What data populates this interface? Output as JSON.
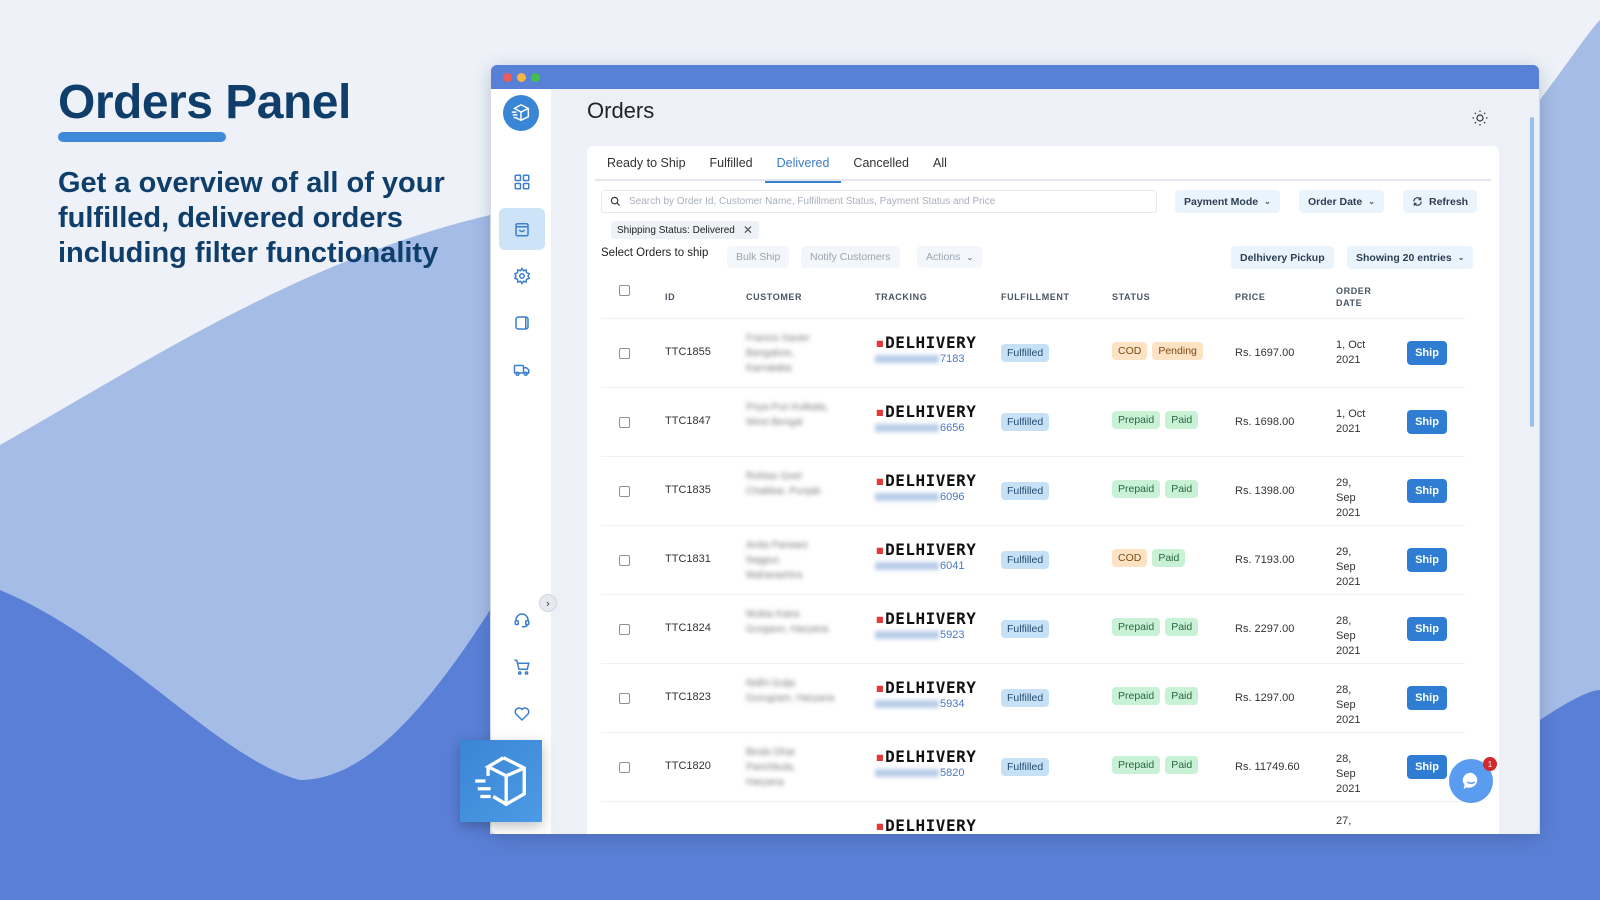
{
  "promo": {
    "title": "Orders Panel",
    "subtitle": "Get a overview of all of your fulfilled, delivered orders including filter functionality"
  },
  "colors": {
    "accent": "#3c7fcc",
    "titlebar": "#5880d6",
    "ship_button": "#2f7dd3",
    "fulfilled_badge": "#c6e1f6",
    "cod_badge": "#fde3c4",
    "prepaid_badge": "#c9f1d6"
  },
  "sidebar": {
    "items": [
      {
        "icon": "dashboard-grid-icon",
        "active": false
      },
      {
        "icon": "shopping-bag-icon",
        "active": true
      },
      {
        "icon": "gear-icon",
        "active": false
      },
      {
        "icon": "document-icon",
        "active": false
      },
      {
        "icon": "truck-icon",
        "active": false
      },
      {
        "icon": "headset-icon",
        "active": false
      },
      {
        "icon": "cart-icon",
        "active": false
      },
      {
        "icon": "heart-icon",
        "active": false
      }
    ],
    "collapse_glyph": "›"
  },
  "header": {
    "title": "Orders"
  },
  "tabs": [
    {
      "label": "Ready to Ship",
      "active": false
    },
    {
      "label": "Fulfilled",
      "active": false
    },
    {
      "label": "Delivered",
      "active": true
    },
    {
      "label": "Cancelled",
      "active": false
    },
    {
      "label": "All",
      "active": false
    }
  ],
  "search": {
    "placeholder": "Search by Order Id, Customer Name, Fulfillment Status, Payment Status and Price",
    "value": ""
  },
  "filters": {
    "payment_mode": "Payment Mode",
    "order_date": "Order Date",
    "refresh": "Refresh",
    "active_chip": "Shipping Status: Delivered"
  },
  "actions": {
    "select_label": "Select Orders to ship",
    "bulk_ship": "Bulk Ship",
    "notify_customers": "Notify Customers",
    "actions": "Actions",
    "pickup": "Delhivery Pickup",
    "entries": "Showing 20 entries"
  },
  "table": {
    "columns": [
      "ID",
      "CUSTOMER",
      "TRACKING",
      "FULFILLMENT",
      "STATUS",
      "PRICE",
      "ORDER DATE"
    ],
    "courier": "DELHIVERY",
    "rows": [
      {
        "id": "TTC1855",
        "customer": "Francis Xavier Bangalore, Karnataka",
        "tracking_suffix": "7183",
        "fulfillment": "Fulfilled",
        "payment": "COD",
        "payment_status": "Pending",
        "price": "Rs. 1697.00",
        "date": "1, Oct 2021",
        "action": "Ship"
      },
      {
        "id": "TTC1847",
        "customer": "Priya Puri Kolkata, West Bengal",
        "tracking_suffix": "6656",
        "fulfillment": "Fulfilled",
        "payment": "Prepaid",
        "payment_status": "Paid",
        "price": "Rs. 1698.00",
        "date": "1, Oct 2021",
        "action": "Ship"
      },
      {
        "id": "TTC1835",
        "customer": "Rohtas Goel Chabbar, Punjab",
        "tracking_suffix": "6096",
        "fulfillment": "Fulfilled",
        "payment": "Prepaid",
        "payment_status": "Paid",
        "price": "Rs. 1398.00",
        "date": "29, Sep 2021",
        "action": "Ship"
      },
      {
        "id": "TTC1831",
        "customer": "Anita Parwani Nagpur, Maharashtra",
        "tracking_suffix": "6041",
        "fulfillment": "Fulfilled",
        "payment": "COD",
        "payment_status": "Paid",
        "price": "Rs. 7193.00",
        "date": "29, Sep 2021",
        "action": "Ship"
      },
      {
        "id": "TTC1824",
        "customer": "Mukta Kaira Gurgaon, Haryana",
        "tracking_suffix": "5923",
        "fulfillment": "Fulfilled",
        "payment": "Prepaid",
        "payment_status": "Paid",
        "price": "Rs. 2297.00",
        "date": "28, Sep 2021",
        "action": "Ship"
      },
      {
        "id": "TTC1823",
        "customer": "Nidhi Gulja Gurugram, Haryana",
        "tracking_suffix": "5934",
        "fulfillment": "Fulfilled",
        "payment": "Prepaid",
        "payment_status": "Paid",
        "price": "Rs. 1297.00",
        "date": "28, Sep 2021",
        "action": "Ship"
      },
      {
        "id": "TTC1820",
        "customer": "Binds Dhar Panchkula, Haryana",
        "tracking_suffix": "5820",
        "fulfillment": "Fulfilled",
        "payment": "Prepaid",
        "payment_status": "Paid",
        "price": "Rs. 11749.60",
        "date": "28, Sep 2021",
        "action": "Ship"
      },
      {
        "id": "",
        "customer": "",
        "tracking_suffix": "",
        "fulfillment": "",
        "payment": "",
        "payment_status": "",
        "price": "",
        "date": "27,",
        "action": ""
      }
    ]
  },
  "chat": {
    "unread_count": "1"
  }
}
